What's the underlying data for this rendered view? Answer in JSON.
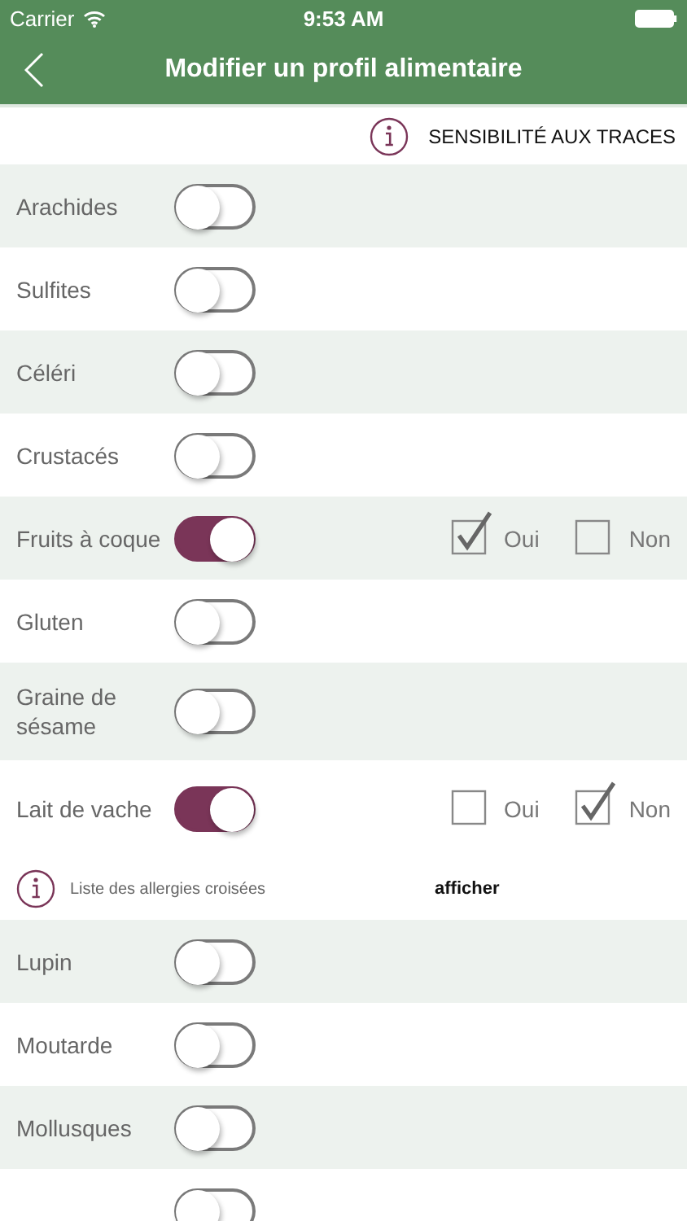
{
  "status_bar": {
    "carrier": "Carrier",
    "time": "9:53 AM"
  },
  "nav": {
    "title": "Modifier un profil alimentaire"
  },
  "header": {
    "label": "SENSIBILITÉ AUX TRACES"
  },
  "allergens": [
    {
      "name": "Arachides",
      "on": false
    },
    {
      "name": "Sulfites",
      "on": false
    },
    {
      "name": "Céléri",
      "on": false
    },
    {
      "name": "Crustacés",
      "on": false
    },
    {
      "name": "Fruits à coque",
      "on": true,
      "traces": [
        {
          "label": "Oui",
          "checked": true
        },
        {
          "label": "Non",
          "checked": false
        }
      ]
    },
    {
      "name": "Gluten",
      "on": false
    },
    {
      "name": "Graine de sésame",
      "on": false
    },
    {
      "name": "Lait de vache",
      "on": true,
      "traces": [
        {
          "label": "Oui",
          "checked": false
        },
        {
          "label": "Non",
          "checked": true
        }
      ],
      "cross": {
        "text": "Liste des allergies croisées",
        "link": "afficher"
      }
    },
    {
      "name": "Lupin",
      "on": false
    },
    {
      "name": "Moutarde",
      "on": false
    },
    {
      "name": "Mollusques",
      "on": false
    },
    {
      "on": false
    }
  ]
}
